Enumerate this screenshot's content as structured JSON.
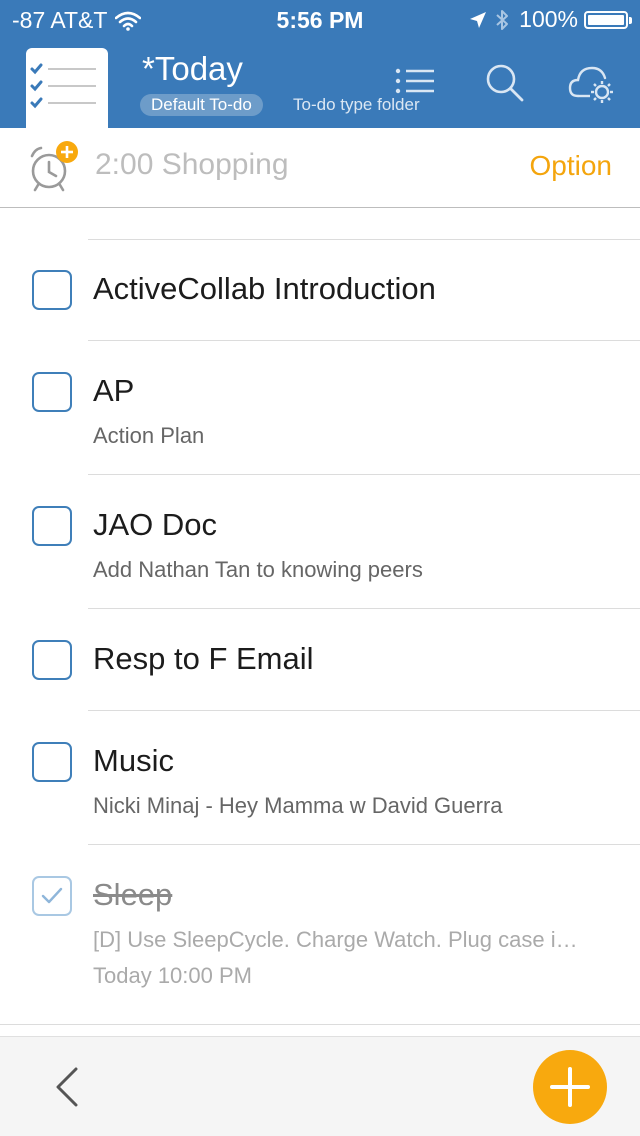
{
  "status_bar": {
    "carrier": "-87 AT&T",
    "time": "5:56 PM",
    "battery": "100%",
    "battery_level": 1.0,
    "icons": [
      "wifi-icon",
      "location-arrow-icon",
      "bluetooth-icon",
      "battery-icon"
    ]
  },
  "header": {
    "title": "*Today",
    "folder_badge": "Default To-do",
    "folder_type": "To-do type folder",
    "icons": [
      "app-logo-icon",
      "list-view-icon",
      "search-icon",
      "cloud-settings-icon"
    ]
  },
  "alarm_bar": {
    "text": "2:00 Shopping",
    "option_label": "Option",
    "icon": "alarm-clock-add-icon"
  },
  "tasks": [
    {
      "title": "ActiveCollab Introduction",
      "subtitle": "",
      "date": "",
      "completed": false
    },
    {
      "title": "AP",
      "subtitle": "Action Plan",
      "date": "",
      "completed": false
    },
    {
      "title": "JAO Doc",
      "subtitle": "Add Nathan Tan to knowing peers",
      "date": "",
      "completed": false
    },
    {
      "title": "Resp to F Email",
      "subtitle": "",
      "date": "",
      "completed": false
    },
    {
      "title": "Music",
      "subtitle": "Nicki Minaj - Hey Mamma w David Guerra",
      "date": "",
      "completed": false
    },
    {
      "title": "Sleep",
      "subtitle": "[D] Use SleepCycle. Charge Watch. Plug case i…",
      "date": "Today 10:00 PM",
      "completed": true
    }
  ],
  "bottom_bar": {
    "icons": [
      "back-chevron-icon",
      "add-plus-icon"
    ]
  },
  "colors": {
    "header_blue": "#3a7ab9",
    "accent_orange": "#f8a90e",
    "option_orange": "#f4a50d",
    "checkbox_blue": "#3f7fb9"
  }
}
